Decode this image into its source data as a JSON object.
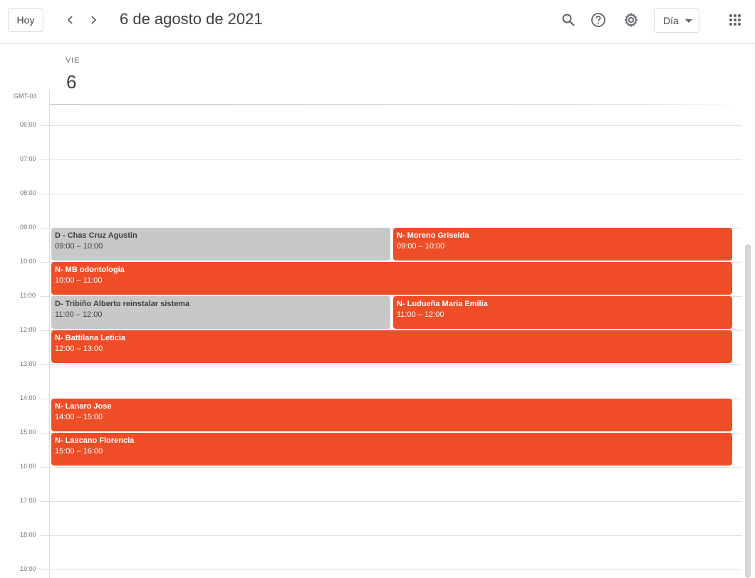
{
  "header": {
    "today_label": "Hoy",
    "prev_icon": "chevron-left-icon",
    "next_icon": "chevron-right-icon",
    "date_title": "6 de agosto de 2021",
    "search_icon": "search-icon",
    "help_icon": "help-icon",
    "settings_icon": "gear-icon",
    "view_label": "Día",
    "apps_icon": "apps-grid-icon"
  },
  "day": {
    "weekday": "VIE",
    "number": "6",
    "timezone": "GMT-03"
  },
  "hours": [
    "06:00",
    "07:00",
    "08:00",
    "09:00",
    "10:00",
    "11:00",
    "12:00",
    "13:00",
    "14:00",
    "15:00",
    "16:00",
    "17:00",
    "18:00",
    "19:00"
  ],
  "events": [
    {
      "title": "D - Chas Cruz Agustin",
      "time": "09:00 – 10:00"
    },
    {
      "title": "N- Moreno Griselda",
      "time": "09:00 – 10:00"
    },
    {
      "title": "N- MB odontologia",
      "time": "10:00 – 11:00"
    },
    {
      "title": "D- Tribiño Alberto reinstalar sistema",
      "time": "11:00 – 12:00"
    },
    {
      "title": "N- Ludueña Maria Emilia",
      "time": "11:00 – 12:00"
    },
    {
      "title": "N- Battilana Leticia",
      "time": "12:00 – 13:00"
    },
    {
      "title": "N- Lanaro Jose",
      "time": "14:00 – 15:00"
    },
    {
      "title": "N- Lascano Florencia",
      "time": "15:00 – 16:00"
    }
  ],
  "colors": {
    "event_orange": "#ef4d27",
    "event_gray": "#c8c8c8"
  }
}
